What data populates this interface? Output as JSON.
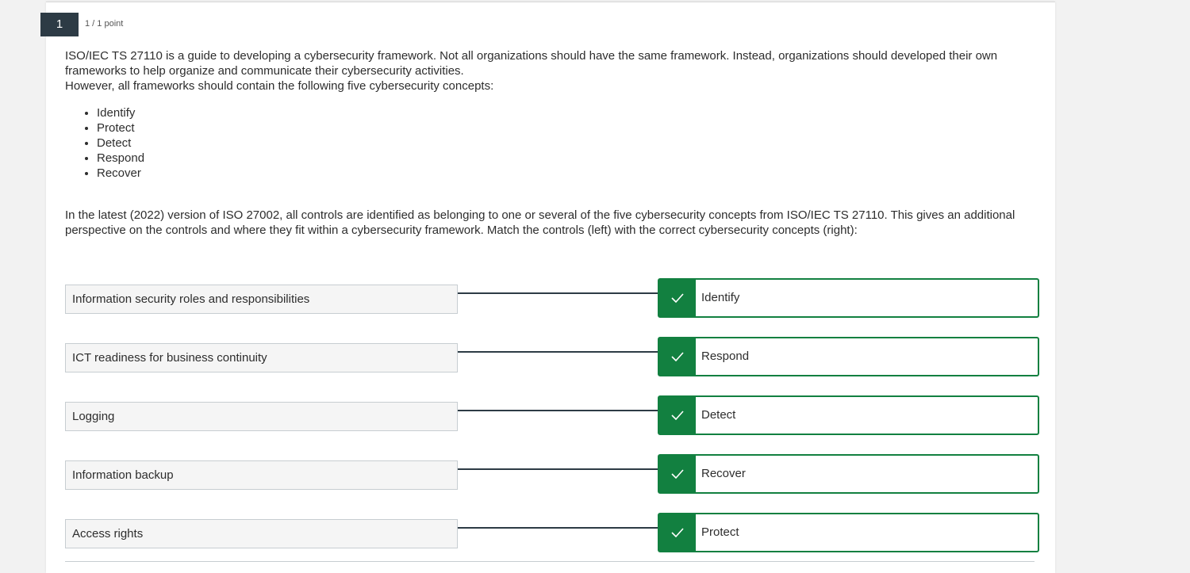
{
  "question": {
    "number": "1",
    "points": "1 / 1 point",
    "paragraph1": "ISO/IEC TS 27110 is a guide to developing a cybersecurity framework. Not all organizations should have the same framework. Instead, organizations should developed their own frameworks to help organize and communicate their cybersecurity activities.",
    "paragraph1b": "However, all frameworks should contain the following five cybersecurity concepts:",
    "concepts": [
      "Identify",
      "Protect",
      "Detect",
      "Respond",
      "Recover"
    ],
    "paragraph2": "In the latest (2022) version of ISO 27002, all controls are identified as belonging to one or several of the five cybersecurity concepts from ISO/IEC TS 27110. This gives an additional perspective on the controls and where they fit within a cybersecurity framework. Match the controls (left) with the correct cybersecurity concepts (right):"
  },
  "matches": [
    {
      "left": "Information security roles and responsibilities",
      "right": "Identify",
      "status": "correct"
    },
    {
      "left": "ICT readiness for business continuity",
      "right": "Respond",
      "status": "correct"
    },
    {
      "left": "Logging",
      "right": "Detect",
      "status": "correct"
    },
    {
      "left": "Information backup",
      "right": "Recover",
      "status": "correct"
    },
    {
      "left": "Access rights",
      "right": "Protect",
      "status": "correct"
    }
  ],
  "colors": {
    "correct": "#128040",
    "question_badge": "#2d3b45",
    "connector": "#2d3b45"
  },
  "icons": {
    "correct_marker": "check-icon"
  }
}
